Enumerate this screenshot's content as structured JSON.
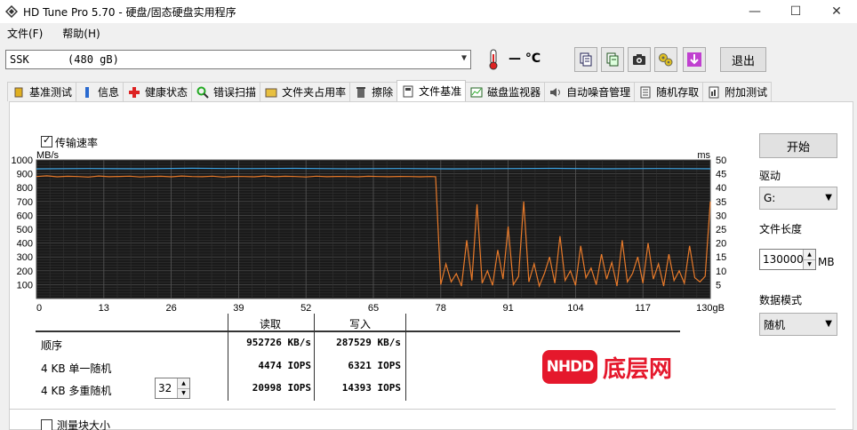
{
  "window": {
    "title": "HD Tune Pro 5.70 - 硬盘/固态硬盘实用程序",
    "controls": [
      "—",
      "☐",
      "✕"
    ]
  },
  "menu": [
    {
      "label": "文件(F)"
    },
    {
      "label": "帮助(H)"
    }
  ],
  "toolbar": {
    "drive": "SSK      (480 gB)",
    "temperature": "— °C",
    "exit_label": "退出"
  },
  "tabs": [
    {
      "label": "基准测试",
      "icon": "benchmark-icon"
    },
    {
      "label": "信息",
      "icon": "info-icon"
    },
    {
      "label": "健康状态",
      "icon": "health-icon"
    },
    {
      "label": "错误扫描",
      "icon": "error-scan-icon"
    },
    {
      "label": "文件夹占用率",
      "icon": "folder-icon"
    },
    {
      "label": "擦除",
      "icon": "erase-icon"
    },
    {
      "label": "文件基准",
      "icon": "file-benchmark-icon",
      "active": true
    },
    {
      "label": "磁盘监视器",
      "icon": "disk-monitor-icon"
    },
    {
      "label": "自动噪音管理",
      "icon": "noise-icon"
    },
    {
      "label": "随机存取",
      "icon": "random-access-icon"
    },
    {
      "label": "附加测试",
      "icon": "extra-tests-icon"
    }
  ],
  "options": {
    "transfer_rate_label": "传输速率",
    "transfer_rate_checked": true,
    "block_size_label": "测量块大小",
    "block_size_checked": false
  },
  "controls": {
    "start_label": "开始",
    "drive_label": "驱动",
    "drive_value": "G:",
    "file_length_label": "文件长度",
    "file_length_value": "130000",
    "file_length_unit": "MB",
    "data_mode_label": "数据模式",
    "data_mode_value": "随机"
  },
  "results": {
    "read_header": "读取",
    "write_header": "写入",
    "rows": [
      {
        "label": "顺序",
        "read": "952726 KB/s",
        "write": "287529 KB/s"
      },
      {
        "label": "4 KB 单一随机",
        "read": "4474 IOPS",
        "write": "6321 IOPS"
      },
      {
        "label": "4 KB 多重随机",
        "read": "20998 IOPS",
        "write": "14393 IOPS"
      }
    ],
    "queue_depth": "32"
  },
  "watermark": {
    "box": "NHDD",
    "text": "底层网"
  },
  "chart_data": {
    "type": "line",
    "ylabel_left": "MB/s",
    "ylabel_right": "ms",
    "xlabel_unit": "gB",
    "y_left_range": [
      0,
      1000
    ],
    "y_right_range": [
      0,
      50
    ],
    "x_range": [
      0,
      130
    ],
    "y_left_ticks": [
      "1000",
      "900",
      "800",
      "700",
      "600",
      "500",
      "400",
      "300",
      "200",
      "100"
    ],
    "y_right_ticks": [
      "50",
      "45",
      "40",
      "35",
      "30",
      "25",
      "20",
      "15",
      "10",
      "5"
    ],
    "x_ticks": [
      "0",
      "13",
      "26",
      "39",
      "52",
      "65",
      "78",
      "91",
      "104",
      "117",
      "130gB"
    ],
    "grid": true,
    "series": [
      {
        "name": "读取",
        "color": "#3aa0e0",
        "x": [
          0,
          10,
          20,
          30,
          40,
          50,
          60,
          70,
          80,
          90,
          100,
          110,
          120,
          130
        ],
        "y": [
          935,
          938,
          936,
          940,
          937,
          939,
          936,
          938,
          935,
          937,
          939,
          936,
          938,
          936
        ]
      },
      {
        "name": "写入",
        "color": "#e87a2a",
        "x": [
          0,
          2,
          4,
          6,
          8,
          10,
          12,
          14,
          16,
          18,
          20,
          22,
          24,
          26,
          28,
          30,
          32,
          34,
          36,
          38,
          40,
          42,
          44,
          46,
          48,
          50,
          52,
          54,
          56,
          58,
          60,
          62,
          64,
          66,
          68,
          70,
          72,
          74,
          76,
          77,
          78,
          79,
          80,
          81,
          82,
          83,
          84,
          85,
          86,
          87,
          88,
          89,
          90,
          91,
          92,
          93,
          94,
          95,
          96,
          97,
          98,
          99,
          100,
          101,
          102,
          103,
          104,
          105,
          106,
          107,
          108,
          109,
          110,
          111,
          112,
          113,
          114,
          115,
          116,
          117,
          118,
          119,
          120,
          121,
          122,
          123,
          124,
          125,
          126,
          127,
          128,
          129,
          130
        ],
        "y": [
          880,
          885,
          878,
          882,
          880,
          876,
          884,
          879,
          881,
          883,
          877,
          880,
          882,
          878,
          884,
          880,
          879,
          883,
          876,
          881,
          880,
          878,
          884,
          879,
          882,
          880,
          877,
          883,
          879,
          881,
          880,
          878,
          882,
          880,
          879,
          881,
          880,
          878,
          880,
          879,
          100,
          250,
          120,
          180,
          90,
          420,
          130,
          680,
          110,
          200,
          95,
          350,
          140,
          520,
          100,
          160,
          700,
          120,
          250,
          90,
          180,
          300,
          110,
          450,
          130,
          200,
          95,
          380,
          150,
          220,
          100,
          320,
          140,
          260,
          90,
          420,
          120,
          180,
          300,
          110,
          400,
          140,
          250,
          90,
          320,
          130,
          200,
          110,
          380,
          150,
          120,
          160,
          700
        ]
      }
    ]
  }
}
